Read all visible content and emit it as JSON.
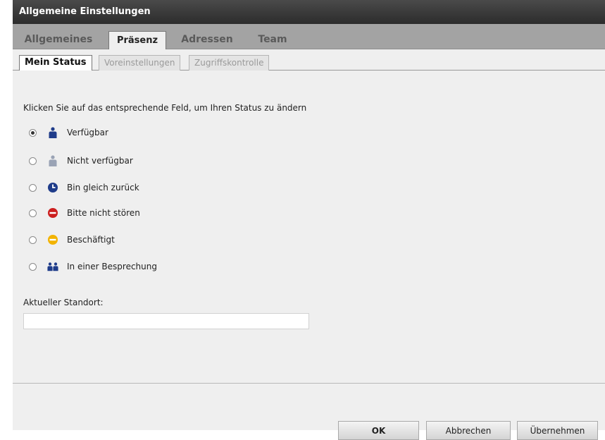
{
  "window": {
    "title": "Allgemeine Einstellungen"
  },
  "main_tabs": [
    {
      "label": "Allgemeines"
    },
    {
      "label": "Präsenz",
      "active": true
    },
    {
      "label": "Adressen"
    },
    {
      "label": "Team"
    }
  ],
  "sub_tabs": [
    {
      "label": "Mein Status",
      "active": true
    },
    {
      "label": "Voreinstellungen"
    },
    {
      "label": "Zugriffskontrolle"
    }
  ],
  "instruction": "Klicken Sie auf das entsprechende Feld, um Ihren Status zu ändern",
  "statuses": [
    {
      "label": "Verfügbar",
      "icon": "person-available-icon",
      "checked": true
    },
    {
      "label": "Nicht verfügbar",
      "icon": "person-unavailable-icon",
      "checked": false
    },
    {
      "label": "Bin gleich zurück",
      "icon": "clock-icon",
      "checked": false
    },
    {
      "label": "Bitte nicht stören",
      "icon": "do-not-disturb-icon",
      "checked": false
    },
    {
      "label": "Beschäftigt",
      "icon": "busy-icon",
      "checked": false
    },
    {
      "label": "In einer Besprechung",
      "icon": "meeting-icon",
      "checked": false
    }
  ],
  "location": {
    "label": "Aktueller Standort:",
    "value": ""
  },
  "buttons": {
    "ok": "OK",
    "cancel": "Abbrechen",
    "apply": "Übernehmen"
  },
  "colors": {
    "available": "#1f3c8a",
    "unavailable": "#9aa3b5",
    "away": "#1f3c8a",
    "dnd": "#cc1f1f",
    "busy": "#f2b300",
    "titlebar": "#2c2c2c"
  }
}
